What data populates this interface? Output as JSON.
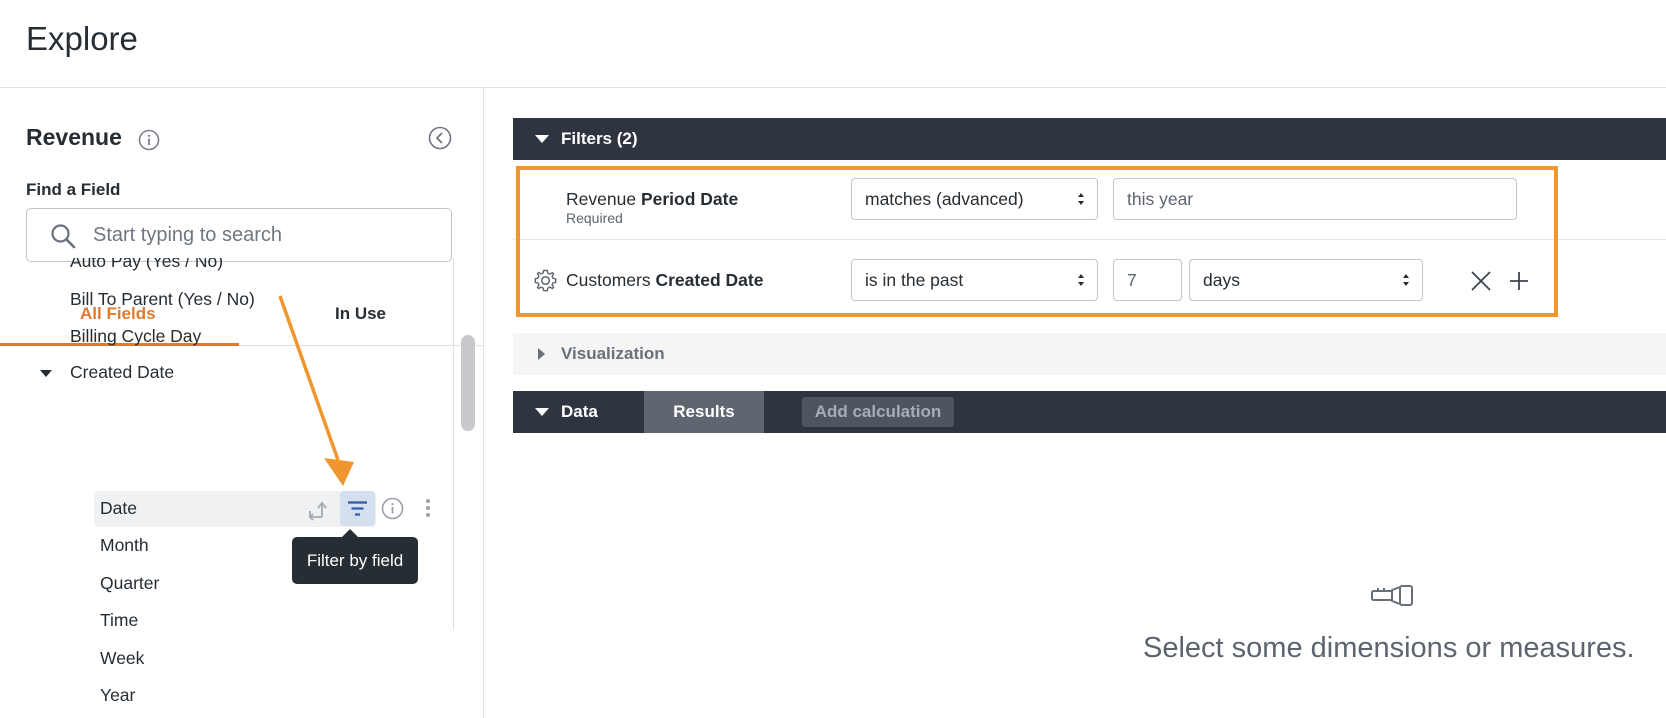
{
  "header": {
    "title": "Explore"
  },
  "sidebar": {
    "explore_name": "Revenue",
    "find_label": "Find a Field",
    "search": {
      "placeholder": "Start typing to search",
      "value": ""
    },
    "tabs": [
      {
        "label": "All Fields",
        "active": true
      },
      {
        "label": "In Use",
        "active": false
      }
    ],
    "fields": [
      "Auto Pay (Yes / No)",
      "Bill To Parent (Yes / No)",
      "Billing Cycle Day",
      "Created Date"
    ],
    "created_date_children": [
      "Date",
      "Month",
      "Quarter",
      "Time",
      "Week",
      "Year"
    ],
    "tooltip": "Filter by field"
  },
  "filters": {
    "title": "Filters (2)",
    "rows": [
      {
        "view": "Revenue",
        "field": "Period Date",
        "sub": "Required",
        "operator": "matches (advanced)",
        "value": "this year"
      },
      {
        "view": "Customers",
        "field": "Created Date",
        "operator": "is in the past",
        "value": "7",
        "unit": "days"
      }
    ]
  },
  "visualization": {
    "title": "Visualization"
  },
  "data": {
    "title": "Data",
    "results_tab": "Results",
    "add_calculation": "Add calculation"
  },
  "empty_state": {
    "message": "Select some dimensions or measures."
  },
  "colors": {
    "accent": "#e07a2f",
    "highlight": "#f0962e",
    "dark_bar": "#2e3440"
  }
}
